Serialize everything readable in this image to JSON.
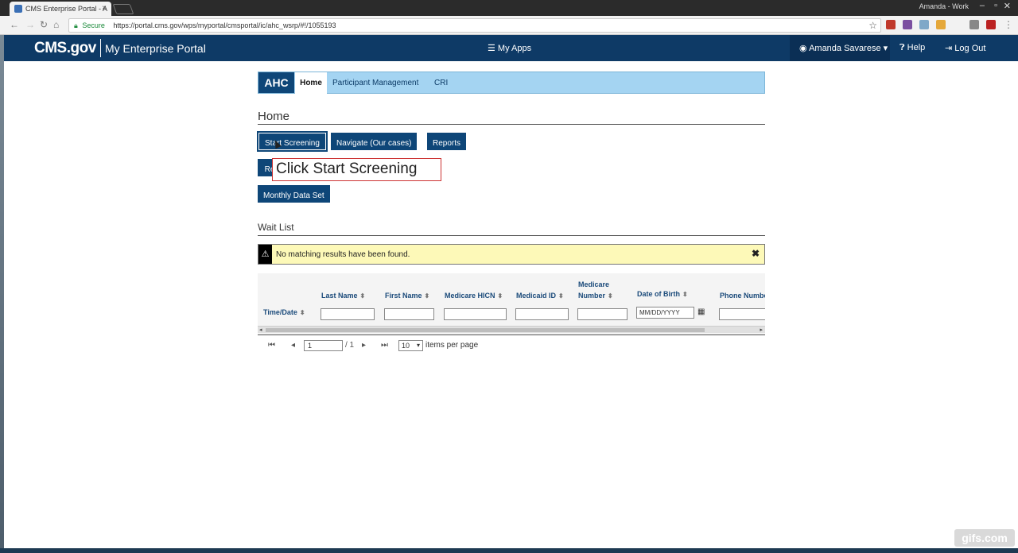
{
  "browser": {
    "tab_title": "CMS Enterprise Portal - A",
    "profile_name": "Amanda - Work",
    "secure_label": "Secure",
    "url": "https://portal.cms.gov/wps/myportal/cmsportal/ic/ahc_wsrp/#!/1055193"
  },
  "header": {
    "logo": "CMS.gov",
    "portal_name": "My Enterprise Portal",
    "my_apps": "My Apps",
    "user": "Amanda Savarese",
    "help": "Help",
    "logout": "Log Out"
  },
  "app_nav": {
    "brand": "AHC",
    "items": [
      "Home",
      "Participant Management",
      "CRI"
    ]
  },
  "home": {
    "title": "Home",
    "buttons": {
      "start_screening": "Start Screening",
      "navigate": "Navigate (Our cases)",
      "reports": "Reports",
      "partial": "Re",
      "monthly": "Monthly Data Set"
    },
    "callout": "Click Start Screening"
  },
  "wait_list": {
    "title": "Wait List",
    "alert": "No matching results have been found.",
    "columns": {
      "time_date": "Time/Date",
      "last_name": "Last Name",
      "first_name": "First Name",
      "medicare_hicn": "Medicare HICN",
      "medicaid_id": "Medicaid ID",
      "medicare_number_1": "Medicare",
      "medicare_number_2": "Number",
      "dob": "Date of Birth",
      "phone": "Phone Numbe"
    },
    "dob_placeholder": "MM/DD/YYYY"
  },
  "pager": {
    "page": "1",
    "total": "/ 1",
    "page_size": "10",
    "items_per_page": "items per page"
  },
  "watermark": "gifs.com"
}
